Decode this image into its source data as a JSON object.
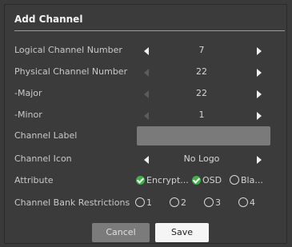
{
  "dialog": {
    "title": "Add Channel",
    "rows": {
      "logical": {
        "label": "Logical Channel Number",
        "value": "7"
      },
      "physical": {
        "label": "Physical Channel Number",
        "value": "22"
      },
      "major": {
        "label": "-Major",
        "value": "22"
      },
      "minor": {
        "label": "-Minor",
        "value": "1"
      },
      "channel_label": {
        "label": "Channel Label",
        "value": ""
      },
      "channel_icon": {
        "label": "Channel Icon",
        "value": "No Logo"
      },
      "attribute": {
        "label": "Attribute",
        "options": [
          {
            "label": "Encrypt...",
            "checked": true
          },
          {
            "label": "OSD",
            "checked": true
          },
          {
            "label": "Bla...",
            "checked": false
          }
        ]
      },
      "bank": {
        "label": "Channel Bank Restrictions",
        "options": [
          {
            "label": "1",
            "selected": false
          },
          {
            "label": "2",
            "selected": false
          },
          {
            "label": "3",
            "selected": false
          },
          {
            "label": "4",
            "selected": false
          }
        ]
      }
    },
    "buttons": {
      "cancel": "Cancel",
      "save": "Save"
    }
  },
  "colors": {
    "accent_check": "#3fb24a",
    "background": "#3b3b3b"
  }
}
